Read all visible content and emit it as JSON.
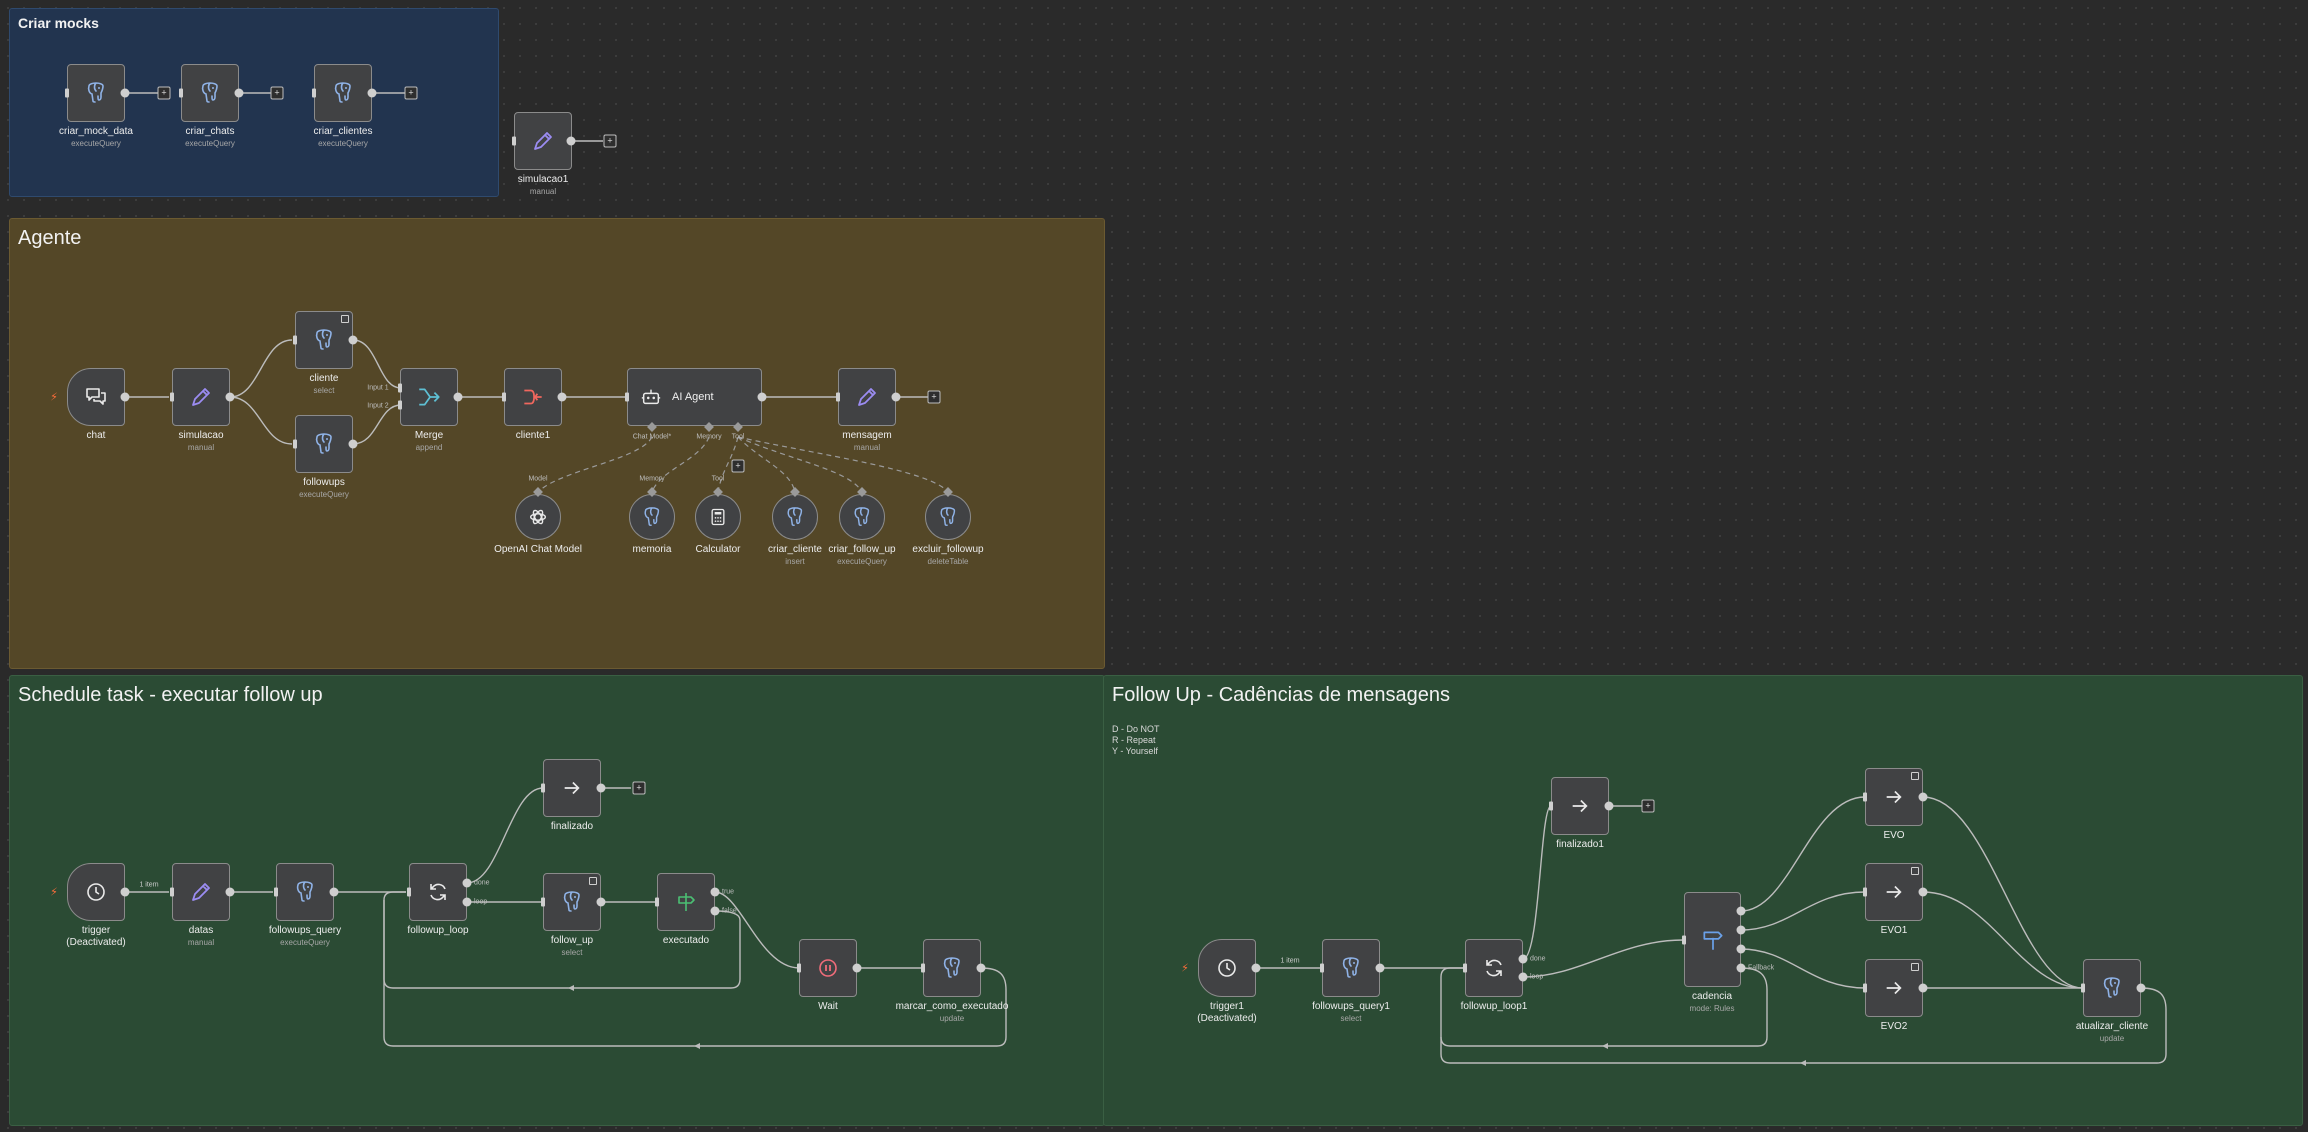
{
  "groups": {
    "mocks": "Criar mocks",
    "agente": "Agente",
    "schedule": "Schedule task - executar follow up",
    "followup": "Follow Up - Cadências de mensagens",
    "sticky": "D - Do NOT\nR - Repeat\nY - Yourself"
  },
  "nodes": {
    "criar_mock_data": {
      "title": "criar_mock_data",
      "sub": "executeQuery"
    },
    "criar_chats": {
      "title": "criar_chats",
      "sub": "executeQuery"
    },
    "criar_clientes": {
      "title": "criar_clientes",
      "sub": "executeQuery"
    },
    "simulacao1": {
      "title": "simulacao1",
      "sub": "manual"
    },
    "chat": {
      "title": "chat",
      "sub": ""
    },
    "simulacao": {
      "title": "simulacao",
      "sub": "manual"
    },
    "cliente": {
      "title": "cliente",
      "sub": "select"
    },
    "followups": {
      "title": "followups",
      "sub": "executeQuery"
    },
    "merge": {
      "title": "Merge",
      "sub": "append"
    },
    "cliente1": {
      "title": "cliente1",
      "sub": ""
    },
    "ai_agent": {
      "title": "AI Agent",
      "sub": ""
    },
    "mensagem": {
      "title": "mensagem",
      "sub": "manual"
    },
    "openai": {
      "title": "OpenAI Chat Model",
      "sub": ""
    },
    "memoria": {
      "title": "memoria",
      "sub": ""
    },
    "calculator": {
      "title": "Calculator",
      "sub": ""
    },
    "criar_cliente": {
      "title": "criar_cliente",
      "sub": "insert"
    },
    "criar_follow_up": {
      "title": "criar_follow_up",
      "sub": "executeQuery"
    },
    "excluir_followup": {
      "title": "excluir_followup",
      "sub": "deleteTable"
    },
    "trigger": {
      "title": "trigger",
      "sub": "(Deactivated)"
    },
    "datas": {
      "title": "datas",
      "sub": "manual"
    },
    "followups_query": {
      "title": "followups_query",
      "sub": "executeQuery"
    },
    "followup_loop": {
      "title": "followup_loop",
      "sub": ""
    },
    "finalizado": {
      "title": "finalizado",
      "sub": ""
    },
    "follow_up": {
      "title": "follow_up",
      "sub": "select"
    },
    "executado": {
      "title": "executado",
      "sub": ""
    },
    "wait": {
      "title": "Wait",
      "sub": ""
    },
    "marcar": {
      "title": "marcar_como_executado",
      "sub": "update"
    },
    "trigger1": {
      "title": "trigger1",
      "sub": "(Deactivated)"
    },
    "followups_query1": {
      "title": "followups_query1",
      "sub": "select"
    },
    "followup_loop1": {
      "title": "followup_loop1",
      "sub": ""
    },
    "finalizado1": {
      "title": "finalizado1",
      "sub": ""
    },
    "cadencia": {
      "title": "cadencia",
      "sub": "mode: Rules"
    },
    "evo": {
      "title": "EVO",
      "sub": ""
    },
    "evo1": {
      "title": "EVO1",
      "sub": ""
    },
    "evo2": {
      "title": "EVO2",
      "sub": ""
    },
    "atualizar_cliente": {
      "title": "atualizar_cliente",
      "sub": "update"
    }
  },
  "ports": {
    "chat_model": "Chat Model*",
    "memory": "Memory",
    "tool": "Tool",
    "input1": "Input 1",
    "input2": "Input 2",
    "model": "Model",
    "memory_sub": "Memory",
    "tool_sub": "Tool",
    "done": "done",
    "loop": "loop",
    "true": "true",
    "false": "false",
    "fallback": "Fallback",
    "one_item": "1 item",
    "plus": "+"
  },
  "icons": {
    "postgres": "elephant-icon",
    "edit": "pencil-icon",
    "chat": "chat-bubbles-icon",
    "merge": "merge-icon",
    "code": "code-icon",
    "robot": "robot-icon",
    "openai": "openai-icon",
    "calculator": "calculator-icon",
    "clock": "clock-icon",
    "loop": "loop-icon",
    "arrow": "arrow-right-icon",
    "if": "signpost-icon",
    "pause": "pause-icon",
    "switch": "switch-icon"
  },
  "colors": {
    "canvas": "#2a2a2a",
    "group_blue": "#22344f",
    "group_brown": "#544727",
    "group_green": "#2b4b34",
    "postgres_icon": "#8fb2e6",
    "edit_icon": "#9b8cf2",
    "merge_icon": "#5ec0d4",
    "code_icon": "#f0675e",
    "if_icon": "#4bbf73",
    "pause_icon": "#f06c7a",
    "trigger_bolt": "#ff6d3a"
  }
}
